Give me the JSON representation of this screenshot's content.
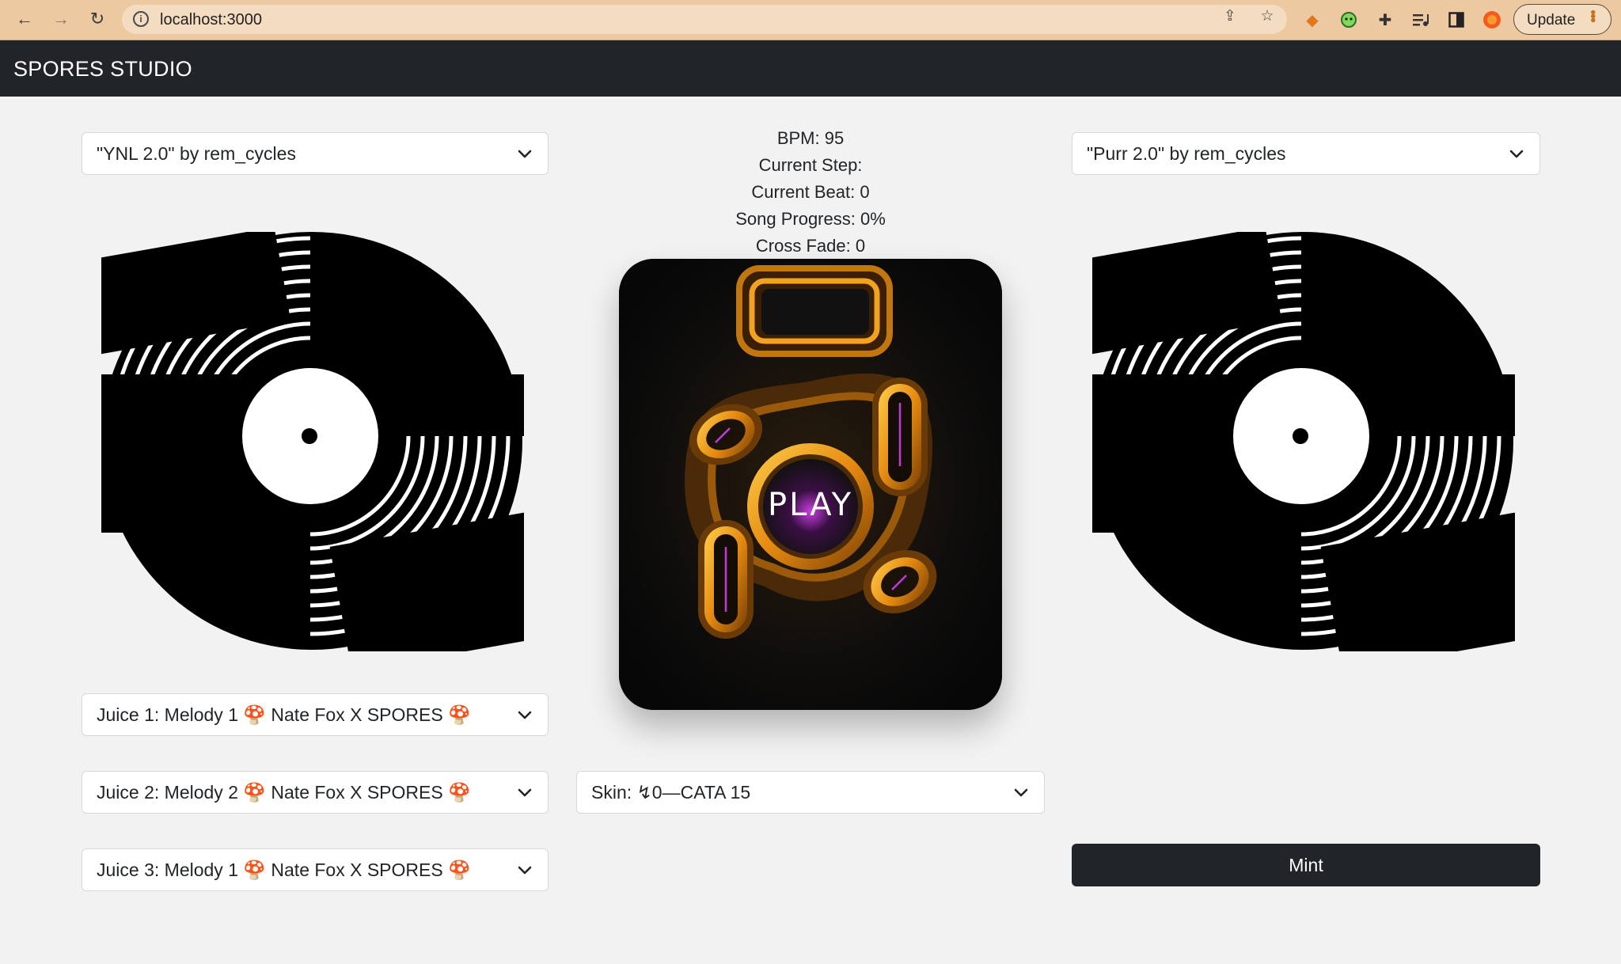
{
  "browser": {
    "url": "localhost:3000",
    "update_label": "Update"
  },
  "app": {
    "brand": "SPORES STUDIO"
  },
  "left_deck": {
    "song_select": "\"YNL 2.0\" by rem_cycles"
  },
  "right_deck": {
    "song_select": "\"Purr 2.0\" by rem_cycles"
  },
  "stats": {
    "bpm": "BPM: 95",
    "current_step": "Current Step:",
    "current_beat": "Current Beat: 0",
    "song_progress": "Song Progress: 0%",
    "cross_fade": "Cross Fade: 0"
  },
  "player": {
    "play_label": "PLAY"
  },
  "juices": [
    {
      "label": "Juice 1: Melody 1 🍄 Nate Fox X SPORES 🍄"
    },
    {
      "label": "Juice 2: Melody 2 🍄 Nate Fox X SPORES 🍄"
    },
    {
      "label": "Juice 3: Melody 1 🍄 Nate Fox X SPORES 🍄"
    }
  ],
  "skin_select": "Skin: ↯0—CATA 15",
  "mint_label": "Mint",
  "colors": {
    "navbar": "#212529",
    "browser_bar": "#ecc9a1",
    "page_bg": "#f2f2f2",
    "player_glow": "#f2a21c",
    "player_accent": "#c13ad8"
  }
}
